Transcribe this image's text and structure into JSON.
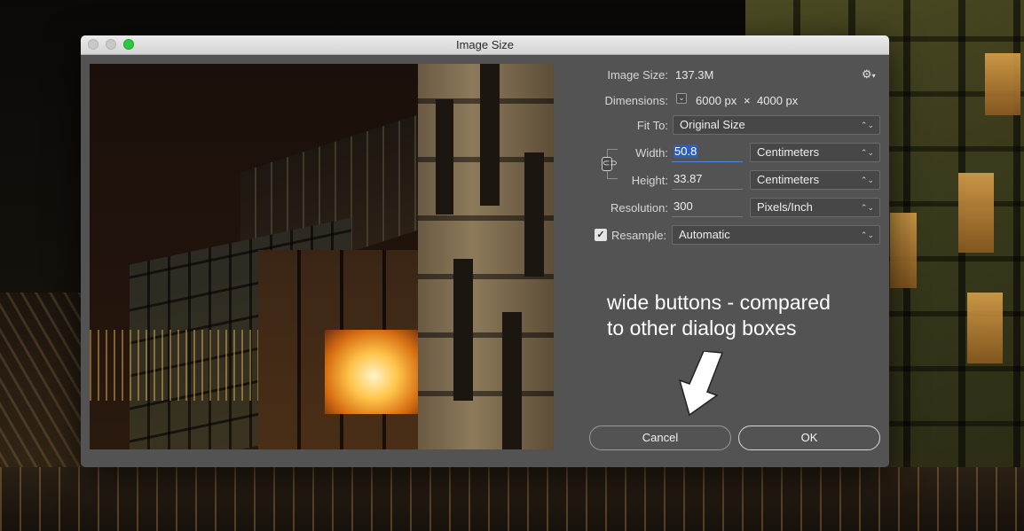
{
  "window": {
    "title": "Image Size"
  },
  "image_size": {
    "label": "Image Size:",
    "value": "137.3M"
  },
  "gear_icon": "⚙",
  "dimensions": {
    "label": "Dimensions:",
    "toggle_icon": "chevron-down-icon",
    "width": "6000 px",
    "times": "×",
    "height": "4000 px"
  },
  "fit_to": {
    "label": "Fit To:",
    "value": "Original Size"
  },
  "width": {
    "label": "Width:",
    "value": "50.8",
    "unit": "Centimeters"
  },
  "height": {
    "label": "Height:",
    "value": "33.87",
    "unit": "Centimeters"
  },
  "resolution": {
    "label": "Resolution:",
    "value": "300",
    "unit": "Pixels/Inch"
  },
  "resample": {
    "checked": true,
    "label": "Resample:",
    "value": "Automatic"
  },
  "buttons": {
    "cancel": "Cancel",
    "ok": "OK"
  },
  "annotation": {
    "line1": "wide buttons - compared",
    "line2": "to other dialog boxes"
  },
  "colors": {
    "dialog_bg": "#535353",
    "accent_zoom": "#2bc840",
    "selection": "#2b5fbf"
  }
}
